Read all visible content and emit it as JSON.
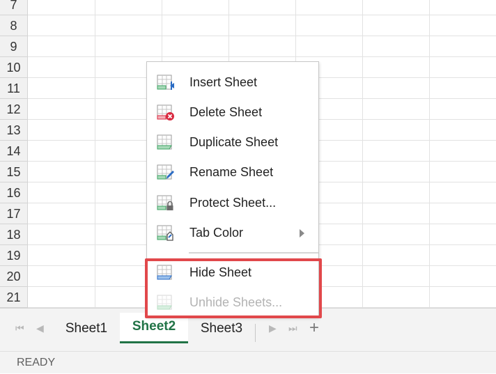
{
  "row_numbers": [
    "7",
    "8",
    "9",
    "10",
    "11",
    "12",
    "13",
    "14",
    "15",
    "16",
    "17",
    "18",
    "19",
    "20",
    "21"
  ],
  "context_menu": {
    "items": [
      {
        "label": "Insert Sheet",
        "icon": "insert-sheet-icon",
        "enabled": true
      },
      {
        "label": "Delete Sheet",
        "icon": "delete-sheet-icon",
        "enabled": true
      },
      {
        "label": "Duplicate Sheet",
        "icon": "duplicate-sheet-icon",
        "enabled": true
      },
      {
        "label": "Rename Sheet",
        "icon": "rename-sheet-icon",
        "enabled": true
      },
      {
        "label": "Protect Sheet...",
        "icon": "protect-sheet-icon",
        "enabled": true
      },
      {
        "label": "Tab Color",
        "icon": "tab-color-icon",
        "enabled": true,
        "submenu": true
      },
      {
        "label": "Hide Sheet",
        "icon": "hide-sheet-icon",
        "enabled": true
      },
      {
        "label": "Unhide Sheets...",
        "icon": "unhide-sheets-icon",
        "enabled": false
      }
    ]
  },
  "sheet_tabs": [
    {
      "label": "Sheet1",
      "active": false
    },
    {
      "label": "Sheet2",
      "active": true
    },
    {
      "label": "Sheet3",
      "active": false
    }
  ],
  "status": {
    "text": "READY"
  },
  "colors": {
    "accent": "#217346",
    "highlight_box": "#e1484b",
    "delete_badge": "#d9293f",
    "edit_pencil": "#2b6cc4"
  }
}
